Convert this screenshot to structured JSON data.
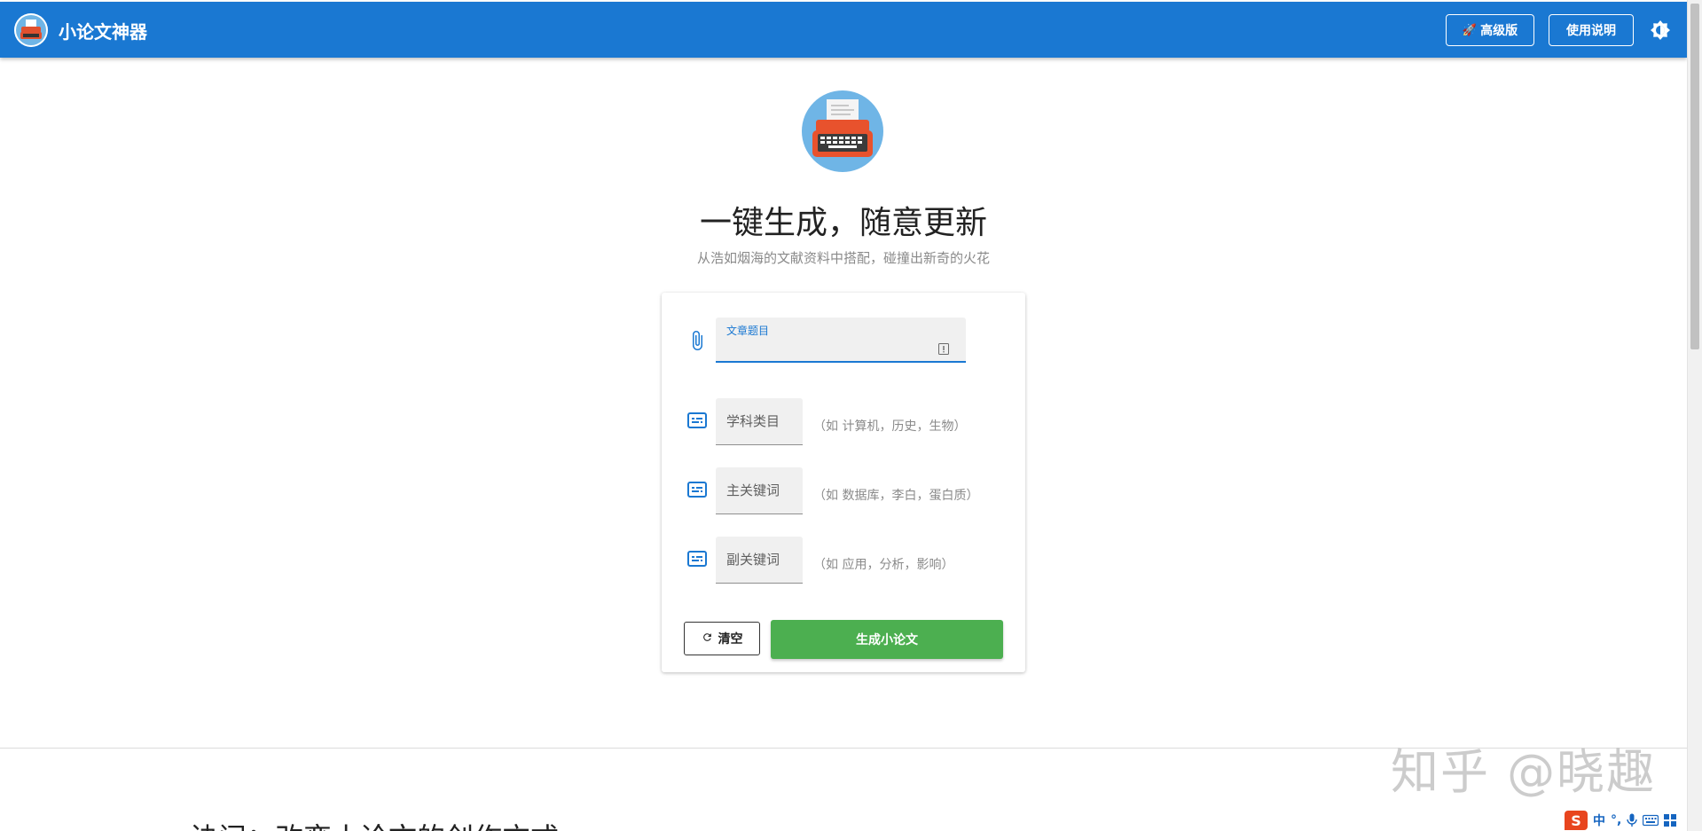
{
  "header": {
    "app_title": "小论文神器",
    "pro_button": "高级版",
    "help_button": "使用说明",
    "bar_color": "#1a78d2"
  },
  "hero": {
    "title": "一键生成，随意更新",
    "subtitle": "从浩如烟海的文献资料中搭配，碰撞出新奇的火花"
  },
  "form": {
    "title_field_label": "文章题目",
    "title_value": "",
    "subject_placeholder": "学科类目",
    "subject_hint": "（如 计算机，历史，生物）",
    "main_keyword_placeholder": "主关键词",
    "main_keyword_hint": "（如 数据库，李白，蛋白质）",
    "sub_keyword_placeholder": "副关键词",
    "sub_keyword_hint": "（如 应用，分析，影响）",
    "clear_button": "清空",
    "generate_button": "生成小论文",
    "generate_color": "#4caf50"
  },
  "lower": {
    "section_heading": "诀问：改变小论文的创作方式",
    "watermark": "知乎 @晓趣"
  },
  "ime": {
    "logo": "S",
    "mode": "中",
    "punct": "°,"
  }
}
